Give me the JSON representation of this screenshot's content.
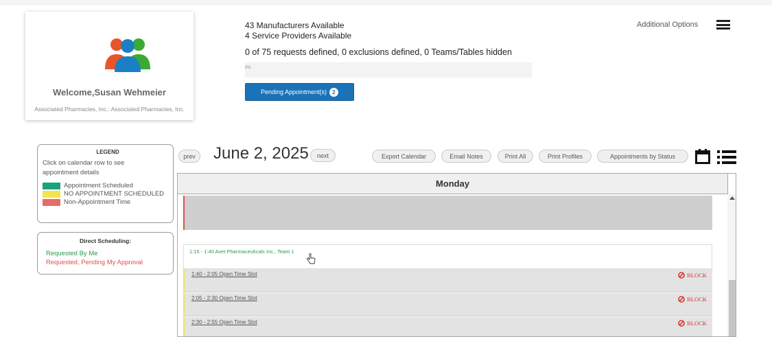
{
  "profile": {
    "welcome": "Welcome,Susan Wehmeier",
    "company": "Associated Pharmacies, Inc.: Associated Pharmacies, Inc.",
    "avatar_icon": "users-group-icon"
  },
  "stats": {
    "manufacturers": "43 Manufacturers Available",
    "providers": "4 Service Providers Available",
    "requests": "0 of 75 requests defined, 0 exclusions defined, 0 Teams/Tables hidden",
    "progress_label": "0%",
    "progress_value": 0,
    "pending_label": "Pending Appointment(s)",
    "pending_count": "2"
  },
  "options": {
    "label": "Additional Options",
    "menu_icon": "hamburger-menu-icon"
  },
  "legend": {
    "title": "LEGEND",
    "hint": "Click on calendar row to see appointment details",
    "items": [
      {
        "label": "Appointment Scheduled",
        "color": "#1aa37a"
      },
      {
        "label": "NO APPOINTMENT SCHEDULED",
        "color": "#f5e34a"
      },
      {
        "label": "Non-Appointment Time",
        "color": "#ea6a65"
      }
    ]
  },
  "direct": {
    "title": "Direct Scheduling:",
    "requested_by_me": "Requested By Me",
    "pending_approval": "Requested, Pending My Approval"
  },
  "toolbar": {
    "prev": "prev",
    "date": "June 2, 2025",
    "next": "next",
    "export": "Export Calendar",
    "email": "Email Notes",
    "print_all": "Print All",
    "print_profiles": "Print Profiles",
    "by_status": "Appointments by Status",
    "calendar_icon": "calendar-icon",
    "list_icon": "list-view-icon"
  },
  "calendar": {
    "day": "Monday",
    "appointment": "1:15 - 1:40 Avet Pharmaceuticals Inc., Team 1",
    "slots": [
      {
        "label": "1:40 - 2:05 Open Time Slot",
        "action": "BLOCK"
      },
      {
        "label": "2:05 - 2:30 Open Time Slot",
        "action": "BLOCK"
      },
      {
        "label": "2:30 - 2:55 Open Time Slot",
        "action": "BLOCK"
      }
    ]
  },
  "colors": {
    "primary": "#1a73b8",
    "green": "#2b9a4b",
    "red": "#e0504a",
    "yellow": "#f5e34a"
  }
}
